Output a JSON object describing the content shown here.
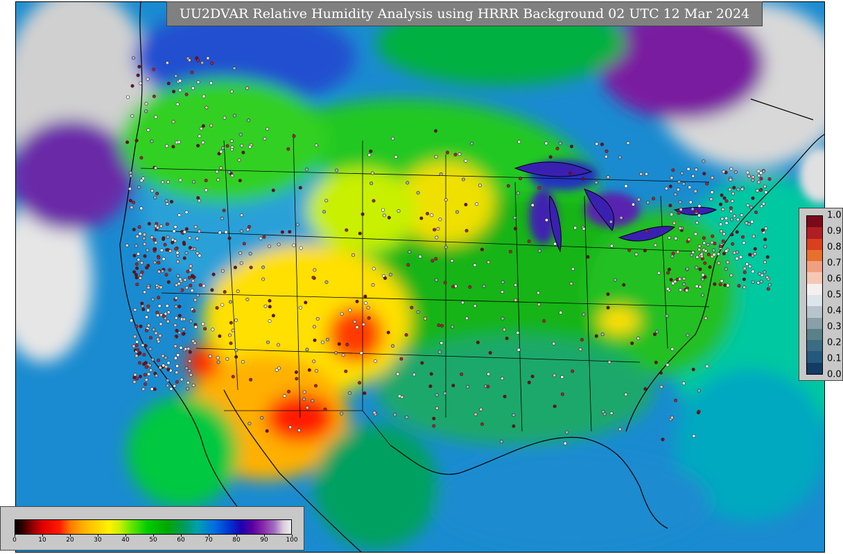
{
  "title": "UU2DVAR Relative Humidity Analysis using HRRR Background 02 UTC 12 Mar 2024",
  "rh_colorbar": {
    "ticks": [
      "0",
      "10",
      "20",
      "30",
      "40",
      "50",
      "60",
      "70",
      "80",
      "90",
      "100"
    ],
    "range": [
      0,
      100
    ]
  },
  "station_colorbar": {
    "labels": [
      "1.0",
      "0.9",
      "0.8",
      "0.7",
      "0.6",
      "0.5",
      "0.4",
      "0.3",
      "0.2",
      "0.1",
      "0.0"
    ],
    "colors": [
      "#7a0a1a",
      "#b01e24",
      "#d84020",
      "#e8702e",
      "#f0a080",
      "#f4c8b4",
      "#f4f0f0",
      "#dde4ec",
      "#b8c4cc",
      "#8aa0a8",
      "#5a8088",
      "#3c6c84",
      "#24587c",
      "#123c64"
    ]
  },
  "colors": {
    "ocean": "#1a8bd0",
    "frame_gray": "#808080",
    "legend_gray": "#c8c8c8"
  }
}
